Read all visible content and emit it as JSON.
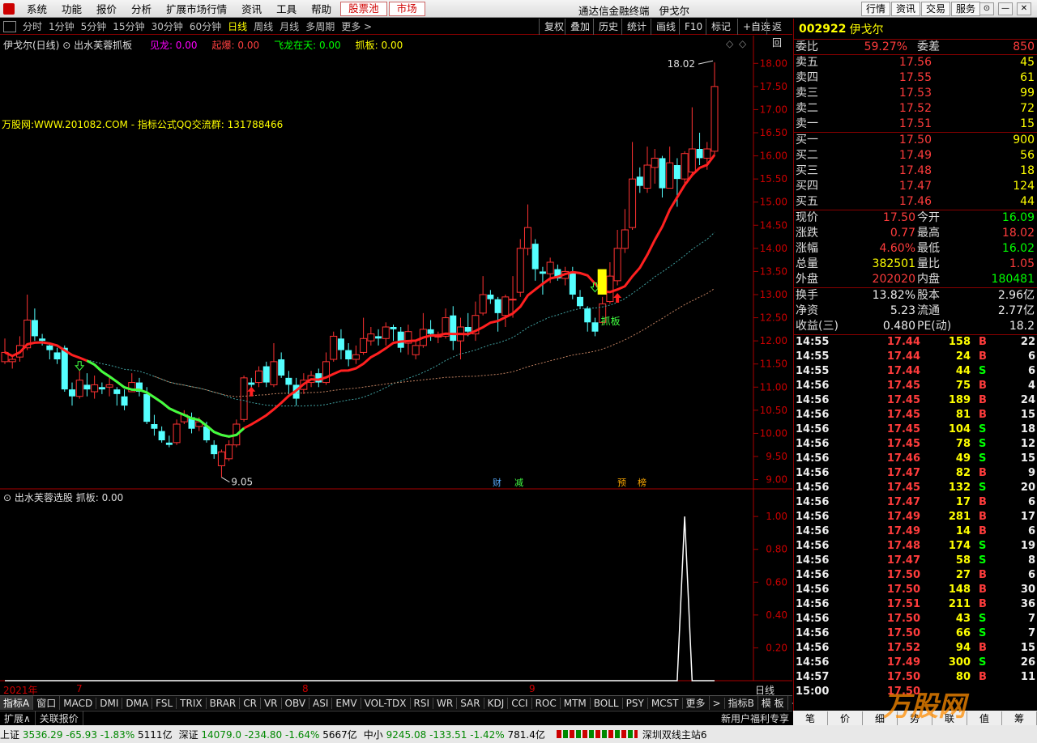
{
  "menu": [
    "系统",
    "功能",
    "报价",
    "分析",
    "扩展市场行情",
    "资讯",
    "工具",
    "帮助"
  ],
  "menu_hl": [
    "股票池",
    "市场"
  ],
  "app_title": "通达信金融终端",
  "stock_title": "伊戈尔",
  "right_buttons": [
    "行情",
    "资讯",
    "交易",
    "服务"
  ],
  "periods": [
    "分时",
    "1分钟",
    "5分钟",
    "15分钟",
    "30分钟",
    "60分钟",
    "日线",
    "周线",
    "月线",
    "多周期",
    "更多 >"
  ],
  "active_period": "日线",
  "tools": [
    "复权",
    "叠加",
    "历史",
    "统计",
    "画线",
    "F10",
    "标记",
    "+自选",
    "返回"
  ],
  "legend": {
    "name": "伊戈尔(日线)",
    "formula": "出水芙蓉抓板",
    "items": [
      {
        "label": "见龙: 0.00",
        "color": "#ff00ff"
      },
      {
        "label": "起爆: 0.00",
        "color": "#ff4040"
      },
      {
        "label": "飞龙在天: 0.00",
        "color": "#00ff00"
      },
      {
        "label": "抓板: 0.00",
        "color": "#ffff00"
      }
    ]
  },
  "ad_text": "万股网:WWW.201082.COM  - 指标公式QQ交流群: 131788466",
  "sub_legend": "出水芙蓉选股 抓板: 0.00",
  "marks": {
    "high": "18.02",
    "low": "9.05",
    "zhuaban": "抓板",
    "cai": "财",
    "jian": "减",
    "yu": "预",
    "bang": "榜"
  },
  "date_labels": [
    {
      "t": "2021年",
      "x": 4
    },
    {
      "t": "7",
      "x": 94
    },
    {
      "t": "8",
      "x": 373
    },
    {
      "t": "9",
      "x": 653
    }
  ],
  "sub_period": "日线",
  "indicator_tabs": [
    "指标A",
    "窗口",
    "MACD",
    "DMI",
    "DMA",
    "FSL",
    "TRIX",
    "BRAR",
    "CR",
    "VR",
    "OBV",
    "ASI",
    "EMV",
    "VOL-TDX",
    "RSI",
    "WR",
    "SAR",
    "KDJ",
    "CCI",
    "ROC",
    "MTM",
    "BOLL",
    "PSY",
    "MCST",
    "更多",
    ">"
  ],
  "indicator_tab_right": [
    "指标B",
    "模 板",
    "+",
    "−"
  ],
  "bottom_tabs": [
    "扩展∧",
    "关联报价"
  ],
  "bottom_right": "新用户福利专享",
  "status": [
    {
      "n": "上证",
      "v": "3536.29",
      "c": "-65.93",
      "p": "-1.83%",
      "a": "5111亿"
    },
    {
      "n": "深证",
      "v": "14079.0",
      "c": "-234.80",
      "p": "-1.64%",
      "a": "5667亿"
    },
    {
      "n": "中小",
      "v": "9245.08",
      "c": "-133.51",
      "p": "-1.42%",
      "a": "781.4亿"
    }
  ],
  "status_site": "深圳双线主站6",
  "right_tabs": [
    "笔",
    "价",
    "细",
    "势",
    "联",
    "值",
    "筹"
  ],
  "quote": {
    "code": "002922",
    "name": "伊戈尔",
    "weibi": {
      "label": "委比",
      "value": "59.27%",
      "label2": "委差",
      "value2": "850"
    },
    "asks": [
      {
        "l": "卖五",
        "p": "17.56",
        "v": "45"
      },
      {
        "l": "卖四",
        "p": "17.55",
        "v": "61"
      },
      {
        "l": "卖三",
        "p": "17.53",
        "v": "99"
      },
      {
        "l": "卖二",
        "p": "17.52",
        "v": "72"
      },
      {
        "l": "卖一",
        "p": "17.51",
        "v": "15"
      }
    ],
    "bids": [
      {
        "l": "买一",
        "p": "17.50",
        "v": "900"
      },
      {
        "l": "买二",
        "p": "17.49",
        "v": "56"
      },
      {
        "l": "买三",
        "p": "17.48",
        "v": "18"
      },
      {
        "l": "买四",
        "p": "17.47",
        "v": "124"
      },
      {
        "l": "买五",
        "p": "17.46",
        "v": "44"
      }
    ],
    "stats1": [
      {
        "l": "现价",
        "v": "17.50",
        "c": "red",
        "l2": "今开",
        "v2": "16.09",
        "c2": "grn"
      },
      {
        "l": "涨跌",
        "v": "0.77",
        "c": "red",
        "l2": "最高",
        "v2": "18.02",
        "c2": "red"
      },
      {
        "l": "涨幅",
        "v": "4.60%",
        "c": "red",
        "l2": "最低",
        "v2": "16.02",
        "c2": "grn"
      },
      {
        "l": "总量",
        "v": "382501",
        "c": "yel",
        "l2": "量比",
        "v2": "1.05",
        "c2": "red"
      },
      {
        "l": "外盘",
        "v": "202020",
        "c": "red",
        "l2": "内盘",
        "v2": "180481",
        "c2": "grn"
      }
    ],
    "stats2": [
      {
        "l": "换手",
        "v": "13.82%",
        "l2": "股本",
        "v2": "2.96亿"
      },
      {
        "l": "净资",
        "v": "5.23",
        "l2": "流通",
        "v2": "2.77亿"
      },
      {
        "l": "收益(三)",
        "v": "0.480",
        "l2": "PE(动)",
        "v2": "18.2"
      }
    ],
    "ticks": [
      [
        "14:55",
        "17.44",
        "158",
        "B",
        "22"
      ],
      [
        "14:55",
        "17.44",
        "24",
        "B",
        "6"
      ],
      [
        "14:55",
        "17.44",
        "44",
        "S",
        "6"
      ],
      [
        "14:56",
        "17.45",
        "75",
        "B",
        "4"
      ],
      [
        "14:56",
        "17.45",
        "189",
        "B",
        "24"
      ],
      [
        "14:56",
        "17.45",
        "81",
        "B",
        "15"
      ],
      [
        "14:56",
        "17.45",
        "104",
        "S",
        "18"
      ],
      [
        "14:56",
        "17.45",
        "78",
        "S",
        "12"
      ],
      [
        "14:56",
        "17.46",
        "49",
        "S",
        "15"
      ],
      [
        "14:56",
        "17.47",
        "82",
        "B",
        "9"
      ],
      [
        "14:56",
        "17.45",
        "132",
        "S",
        "20"
      ],
      [
        "14:56",
        "17.47",
        "17",
        "B",
        "6"
      ],
      [
        "14:56",
        "17.49",
        "281",
        "B",
        "17"
      ],
      [
        "14:56",
        "17.49",
        "14",
        "B",
        "6"
      ],
      [
        "14:56",
        "17.48",
        "174",
        "S",
        "19"
      ],
      [
        "14:56",
        "17.47",
        "58",
        "S",
        "8"
      ],
      [
        "14:56",
        "17.50",
        "27",
        "B",
        "6"
      ],
      [
        "14:56",
        "17.50",
        "148",
        "B",
        "30"
      ],
      [
        "14:56",
        "17.51",
        "211",
        "B",
        "36"
      ],
      [
        "14:56",
        "17.50",
        "43",
        "S",
        "7"
      ],
      [
        "14:56",
        "17.50",
        "66",
        "S",
        "7"
      ],
      [
        "14:56",
        "17.52",
        "94",
        "B",
        "15"
      ],
      [
        "14:56",
        "17.49",
        "300",
        "S",
        "26"
      ],
      [
        "14:57",
        "17.50",
        "80",
        "B",
        "11"
      ],
      [
        "15:00",
        "17.50",
        "",
        "",
        ""
      ]
    ]
  },
  "chart_data": {
    "type": "candlestick",
    "yaxis_main": {
      "ticks": [
        "18.00",
        "17.50",
        "17.00",
        "16.50",
        "16.00",
        "15.50",
        "15.00",
        "14.50",
        "14.00",
        "13.50",
        "13.00",
        "12.50",
        "12.00",
        "11.50",
        "11.00",
        "10.50",
        "10.00",
        "9.50",
        "9.00"
      ],
      "ylim": [
        8.8,
        18.6
      ]
    },
    "yaxis_sub": {
      "ticks": [
        "1.00",
        "0.80",
        "0.60",
        "0.40",
        "0.20"
      ],
      "ylim": [
        0,
        1.05
      ]
    },
    "candles": [
      [
        11.55,
        11.75,
        12.05,
        11.5
      ],
      [
        11.55,
        11.6,
        11.7,
        11.4
      ],
      [
        11.65,
        11.9,
        12.1,
        11.55
      ],
      [
        11.85,
        12.45,
        13.0,
        11.8
      ],
      [
        12.45,
        12.1,
        12.7,
        12.0
      ],
      [
        12.05,
        12.0,
        12.15,
        11.9
      ],
      [
        11.9,
        11.8,
        11.95,
        11.6
      ],
      [
        11.75,
        11.6,
        11.85,
        11.5
      ],
      [
        11.85,
        10.95,
        11.9,
        10.9
      ],
      [
        10.95,
        10.8,
        11.1,
        10.6
      ],
      [
        10.8,
        11.15,
        11.35,
        10.75
      ],
      [
        11.05,
        10.95,
        11.3,
        10.8
      ],
      [
        10.9,
        11.05,
        11.25,
        10.75
      ],
      [
        11.0,
        10.95,
        11.1,
        10.85
      ],
      [
        11.0,
        11.05,
        11.2,
        10.8
      ],
      [
        10.95,
        10.85,
        11.0,
        10.6
      ],
      [
        10.8,
        10.6,
        10.95,
        10.5
      ],
      [
        10.9,
        11.1,
        11.3,
        10.9
      ],
      [
        11.1,
        10.9,
        11.2,
        10.8
      ],
      [
        10.85,
        10.25,
        11.0,
        10.2
      ],
      [
        10.2,
        10.1,
        10.4,
        9.95
      ],
      [
        10.05,
        9.85,
        10.15,
        9.8
      ],
      [
        9.8,
        9.75,
        9.95,
        9.7
      ],
      [
        9.8,
        10.2,
        10.3,
        9.75
      ],
      [
        10.25,
        10.4,
        10.5,
        10.2
      ],
      [
        10.35,
        10.1,
        10.45,
        10.0
      ],
      [
        10.15,
        10.25,
        10.35,
        10.05
      ],
      [
        10.15,
        9.85,
        10.25,
        9.8
      ],
      [
        9.75,
        9.55,
        9.85,
        9.45
      ],
      [
        9.3,
        9.6,
        9.65,
        9.05
      ],
      [
        9.45,
        9.75,
        9.85,
        9.4
      ],
      [
        9.75,
        10.2,
        10.3,
        9.7
      ],
      [
        10.3,
        11.2,
        11.25,
        10.25
      ],
      [
        11.1,
        11.05,
        11.2,
        10.95
      ],
      [
        11.1,
        11.35,
        11.45,
        11.0
      ],
      [
        11.45,
        11.1,
        11.55,
        11.0
      ],
      [
        11.05,
        11.55,
        11.95,
        11.0
      ],
      [
        11.6,
        11.25,
        11.75,
        11.2
      ],
      [
        11.2,
        11.05,
        11.35,
        10.85
      ],
      [
        11.05,
        10.75,
        11.2,
        10.6
      ],
      [
        10.95,
        11.15,
        11.3,
        10.85
      ],
      [
        11.1,
        11.25,
        11.35,
        11.0
      ],
      [
        11.3,
        11.1,
        11.4,
        11.0
      ],
      [
        11.1,
        11.55,
        11.75,
        11.05
      ],
      [
        11.6,
        12.1,
        12.2,
        11.55
      ],
      [
        12.05,
        11.8,
        12.25,
        11.6
      ],
      [
        11.8,
        11.6,
        11.95,
        11.45
      ],
      [
        11.6,
        11.7,
        11.9,
        11.5
      ],
      [
        11.75,
        12.05,
        12.5,
        11.7
      ],
      [
        12.0,
        12.15,
        12.3,
        11.9
      ],
      [
        12.1,
        12.05,
        12.25,
        11.9
      ],
      [
        12.05,
        12.3,
        12.4,
        11.9
      ],
      [
        12.3,
        12.25,
        12.35,
        12.0
      ],
      [
        12.2,
        11.85,
        12.3,
        11.75
      ],
      [
        11.95,
        12.2,
        12.35,
        11.7
      ],
      [
        11.7,
        11.9,
        12.0,
        11.6
      ],
      [
        11.9,
        12.25,
        12.6,
        11.85
      ],
      [
        12.25,
        12.15,
        12.45,
        12.0
      ],
      [
        12.1,
        12.1,
        12.2,
        11.95
      ],
      [
        12.1,
        12.5,
        12.7,
        12.05
      ],
      [
        12.55,
        12.0,
        12.75,
        11.8
      ],
      [
        12.0,
        12.3,
        12.5,
        11.6
      ],
      [
        12.3,
        12.2,
        12.6,
        12.1
      ],
      [
        12.15,
        12.55,
        12.85,
        12.0
      ],
      [
        12.6,
        13.0,
        13.4,
        12.55
      ],
      [
        13.0,
        12.9,
        13.1,
        12.8
      ],
      [
        12.9,
        12.6,
        12.95,
        12.2
      ],
      [
        12.55,
        12.95,
        13.0,
        12.3
      ],
      [
        12.9,
        12.9,
        13.4,
        12.5
      ],
      [
        13.05,
        14.0,
        14.2,
        12.95
      ],
      [
        14.0,
        14.45,
        14.95,
        13.85
      ],
      [
        14.1,
        13.55,
        14.2,
        13.3
      ],
      [
        13.5,
        13.45,
        13.6,
        13.0
      ],
      [
        13.45,
        13.7,
        13.8,
        13.25
      ],
      [
        13.55,
        13.35,
        13.65,
        13.3
      ],
      [
        13.35,
        13.5,
        13.6,
        13.2
      ],
      [
        13.5,
        13.0,
        13.6,
        12.9
      ],
      [
        12.95,
        12.75,
        13.1,
        12.7
      ],
      [
        12.7,
        12.4,
        12.75,
        12.2
      ],
      [
        12.4,
        12.2,
        12.5,
        12.1
      ],
      [
        12.4,
        12.8,
        12.95,
        12.35
      ],
      [
        12.85,
        13.4,
        13.7,
        12.8
      ],
      [
        13.3,
        14.0,
        14.4,
        13.2
      ],
      [
        14.0,
        14.4,
        14.85,
        13.9
      ],
      [
        14.45,
        15.5,
        16.3,
        14.4
      ],
      [
        15.55,
        15.35,
        15.75,
        15.2
      ],
      [
        15.3,
        15.8,
        16.2,
        15.2
      ],
      [
        15.75,
        15.95,
        16.15,
        15.4
      ],
      [
        15.95,
        15.3,
        16.0,
        15.1
      ],
      [
        15.3,
        15.85,
        16.2,
        15.3
      ],
      [
        15.8,
        15.5,
        15.95,
        14.9
      ],
      [
        15.5,
        16.05,
        16.1,
        15.4
      ],
      [
        15.65,
        16.15,
        17.05,
        15.6
      ],
      [
        16.15,
        15.95,
        16.5,
        15.8
      ],
      [
        15.95,
        16.15,
        16.3,
        15.7
      ],
      [
        16.1,
        17.5,
        18.02,
        16.02
      ]
    ],
    "signal_sub": {
      "peak_index": 91,
      "value": 1.0
    },
    "markers": [
      {
        "type": "arrow-up-red",
        "index": 33
      },
      {
        "type": "arrow-down-green",
        "index": 10
      },
      {
        "type": "arrow-down-green",
        "index": 79
      },
      {
        "type": "arrow-up-red",
        "index": 82
      },
      {
        "type": "yellow-block",
        "index": 80
      }
    ]
  }
}
